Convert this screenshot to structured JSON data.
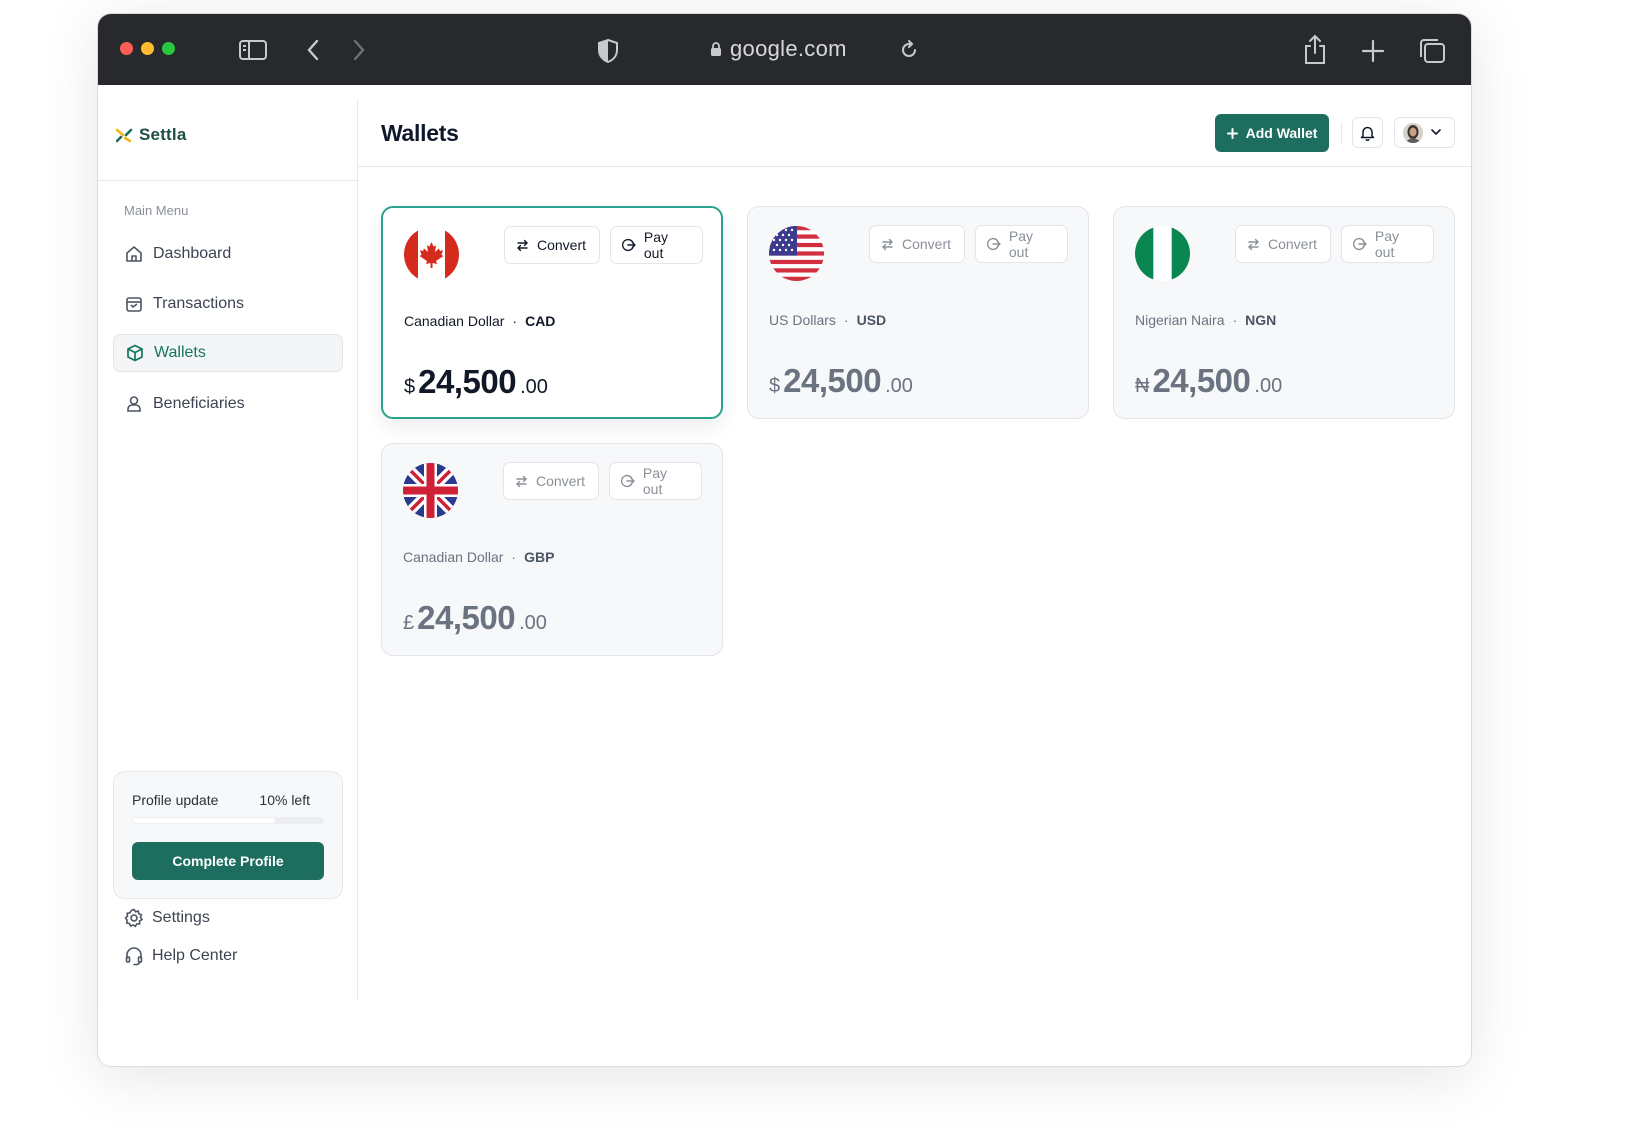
{
  "browser": {
    "url": "google.com"
  },
  "brand": {
    "name": "Settla"
  },
  "sidebar": {
    "menu_caption": "Main Menu",
    "items": [
      {
        "label": "Dashboard",
        "icon": "home-icon",
        "active": false
      },
      {
        "label": "Transactions",
        "icon": "calendar-icon",
        "active": false
      },
      {
        "label": "Wallets",
        "icon": "box-icon",
        "active": true
      },
      {
        "label": "Beneficiaries",
        "icon": "user-icon",
        "active": false
      }
    ],
    "profile": {
      "title": "Profile update",
      "remaining": "10% left",
      "progress_fraction": 0.75,
      "button_label": "Complete Profile"
    },
    "footer": [
      {
        "label": "Settings",
        "icon": "gear-icon"
      },
      {
        "label": "Help Center",
        "icon": "headset-icon"
      }
    ]
  },
  "header": {
    "title": "Wallets",
    "add_wallet_label": "Add Wallet"
  },
  "wallets": [
    {
      "flag": "canada-flag-icon",
      "name": "Canadian Dollar",
      "code": "CAD",
      "symbol": "$",
      "amount_int": "24,500",
      "amount_dec": ".00",
      "convert_label": "Convert",
      "payout_label": "Pay out",
      "selected": true
    },
    {
      "flag": "usa-flag-icon",
      "name": "US Dollars",
      "code": "USD",
      "symbol": "$",
      "amount_int": "24,500",
      "amount_dec": ".00",
      "convert_label": "Convert",
      "payout_label": "Pay out",
      "selected": false
    },
    {
      "flag": "nigeria-flag-icon",
      "name": "Nigerian Naira",
      "code": "NGN",
      "symbol": "₦",
      "amount_int": "24,500",
      "amount_dec": ".00",
      "convert_label": "Convert",
      "payout_label": "Pay out",
      "selected": false
    },
    {
      "flag": "uk-flag-icon",
      "name": "Canadian Dollar",
      "code": "GBP",
      "symbol": "£",
      "amount_int": "24,500",
      "amount_dec": ".00",
      "convert_label": "Convert",
      "payout_label": "Pay out",
      "selected": false
    }
  ],
  "colors": {
    "brand_green": "#1d6e5e",
    "active_green": "#16755f",
    "selected_border": "#2aa28d"
  }
}
